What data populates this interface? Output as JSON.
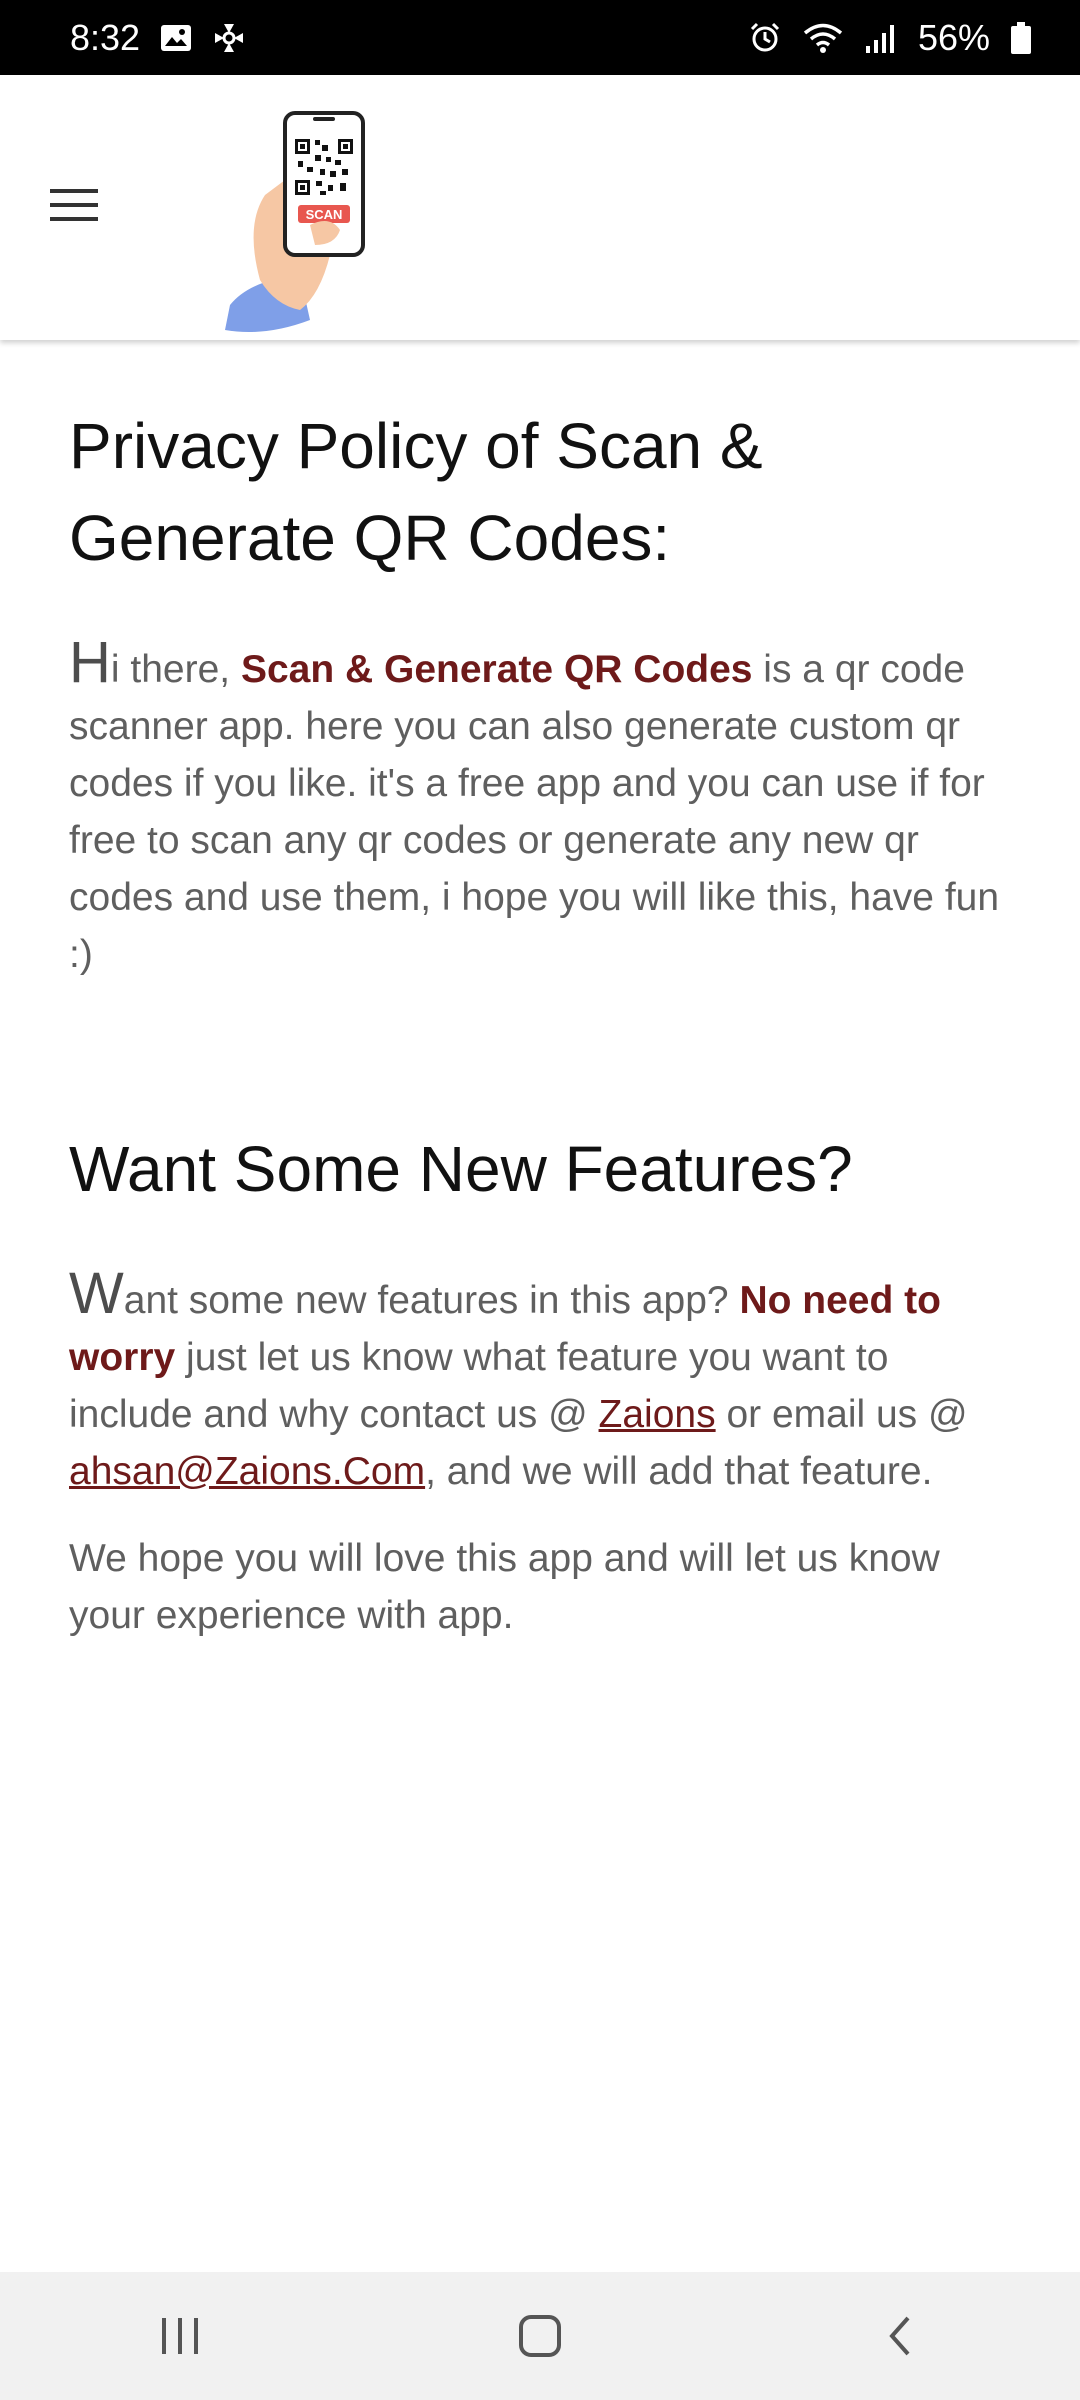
{
  "status_bar": {
    "time": "8:32",
    "battery": "56%",
    "icons": [
      "image-icon",
      "pinwheel-icon",
      "alarm-icon",
      "wifi-icon",
      "signal-icon",
      "battery-icon"
    ]
  },
  "app_bar": {
    "menu_icon": "hamburger-menu-icon",
    "logo_text": "SCAN"
  },
  "section1": {
    "heading": "Privacy Policy of Scan & Generate QR Codes:",
    "dropcap": "H",
    "p1_a": "i there, ",
    "p1_b": "Scan & Generate QR Codes",
    "p1_c": " is a qr code scanner app. here you can also generate custom qr codes if you like. it's a free app and you can use if for free to scan any qr codes or generate any new qr codes and use them, i hope you will like this, have fun :)"
  },
  "section2": {
    "heading": "Want Some New Features?",
    "dropcap": "W",
    "p1_a": "ant some new features in this app? ",
    "p1_b": "No need to worry",
    "p1_c": " just let us know what feature you want to include and why contact us @ ",
    "link1": "Zaions",
    "p1_d": " or email us @ ",
    "link2": "ahsan@Zaions.Com",
    "p1_e": ", and we will add that feature.",
    "p2": "We hope you will love this app and will let us know your experience with app."
  },
  "nav_bar": {
    "icons": [
      "recent-apps-icon",
      "home-icon",
      "back-icon"
    ]
  },
  "colors": {
    "accent": "#6e1a1a",
    "body_text": "#5f5f5f",
    "heading": "#111111"
  }
}
